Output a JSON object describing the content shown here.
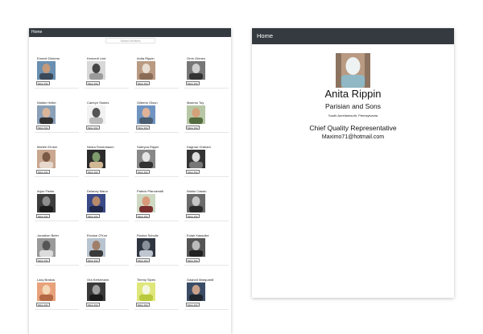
{
  "list_panel": {
    "nav_title": "Home",
    "search": {
      "placeholder": "Search Workers",
      "value": ""
    },
    "more_info_label": "More Info",
    "people": [
      {
        "name": "Emmet Dickens",
        "palette": [
          "#6a8fb0",
          "#c49a7a",
          "#3b4a5a"
        ]
      },
      {
        "name": "Kennedi Lind",
        "palette": [
          "#d8d8d8",
          "#444444",
          "#9a9a9a"
        ]
      },
      {
        "name": "Anita Rippin",
        "palette": [
          "#b99a82",
          "#e8ddd2",
          "#8a6b55"
        ]
      },
      {
        "name": "Orrin Grimes",
        "palette": [
          "#777777",
          "#cfcfcf",
          "#333333"
        ]
      },
      {
        "name": "Walker Heller",
        "palette": [
          "#8aa0b8",
          "#d9b59a",
          "#333333"
        ]
      },
      {
        "name": "Camryn Stokes",
        "palette": [
          "#f2f2f2",
          "#555555",
          "#bbbbbb"
        ]
      },
      {
        "name": "Gilberto Olson",
        "palette": [
          "#6f94c2",
          "#e0b398",
          "#4a5d72"
        ]
      },
      {
        "name": "Maximo Toy",
        "palette": [
          "#b7c7a6",
          "#d4a27a",
          "#556b40"
        ]
      },
      {
        "name": "Marlee Ernser",
        "palette": [
          "#c9a790",
          "#7a5a44",
          "#e6d8cc"
        ]
      },
      {
        "name": "Nedra Rosenbaum",
        "palette": [
          "#2b2b2b",
          "#7f9c6d",
          "#d1b894"
        ]
      },
      {
        "name": "Sabryna Rippin",
        "palette": [
          "#888888",
          "#e5e5e5",
          "#333333"
        ]
      },
      {
        "name": "Dagmar Graham",
        "palette": [
          "#333333",
          "#dddddd",
          "#777777"
        ]
      },
      {
        "name": "Arjun Fisher",
        "palette": [
          "#3d3d3d",
          "#8e8e8e",
          "#1c1c1c"
        ]
      },
      {
        "name": "Delaney Mann",
        "palette": [
          "#3a4a88",
          "#b88a6c",
          "#1f274a"
        ]
      },
      {
        "name": "Patrick Pfannerstill",
        "palette": [
          "#cdd9c2",
          "#d89a7a",
          "#7a2f2f"
        ]
      },
      {
        "name": "Waldo Cassin",
        "palette": [
          "#6b6b6b",
          "#c7c7c7",
          "#2c2c2c"
        ]
      },
      {
        "name": "Jonathon Beier",
        "palette": [
          "#9a9a9a",
          "#555555",
          "#dcdcdc"
        ]
      },
      {
        "name": "Elouise O'Kon",
        "palette": [
          "#b8c4cf",
          "#a07f6a",
          "#3a3a3a"
        ]
      },
      {
        "name": "Rosina Schultz",
        "palette": [
          "#2f3540",
          "#8a9099",
          "#c0c6cf"
        ]
      },
      {
        "name": "Eulah Kassulke",
        "palette": [
          "#555555",
          "#bbbbbb",
          "#222222"
        ]
      },
      {
        "name": "Lacy Brakus",
        "palette": [
          "#e8a27c",
          "#f4d9b8",
          "#b36a44"
        ]
      },
      {
        "name": "Ora Kertzmann",
        "palette": [
          "#3a3a3a",
          "#9f9f9f",
          "#1a1a1a"
        ]
      },
      {
        "name": "Timmy Sipes",
        "palette": [
          "#dfe77a",
          "#f4f7e0",
          "#b8c93c"
        ]
      },
      {
        "name": "Gaylord Marquardt",
        "palette": [
          "#3b4d66",
          "#c8a08a",
          "#20242c"
        ]
      }
    ]
  },
  "detail": {
    "nav_title": "Home",
    "name": "Anita Rippin",
    "company": "Parisian and Sons",
    "location": "South Aureliamouth, Pennsylvania",
    "title": "Chief Quality Representative",
    "email": "Maximo71@hotmail.com",
    "photo_palette": [
      "#b99a82",
      "#eef2f2",
      "#8fb8c4"
    ]
  }
}
